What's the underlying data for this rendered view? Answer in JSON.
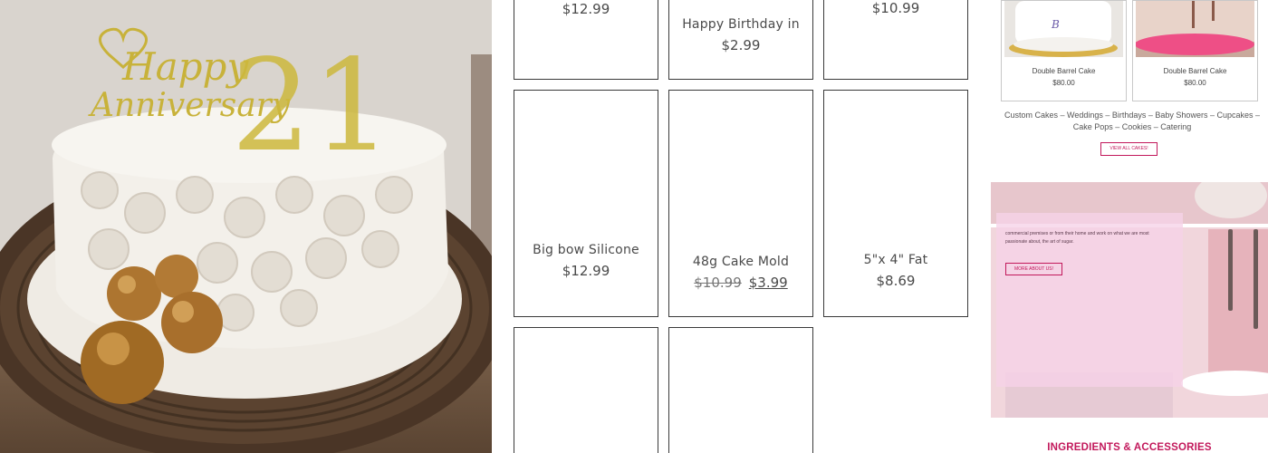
{
  "products": [
    {
      "id": "p1",
      "name": "",
      "price": "$12.99"
    },
    {
      "id": "p2",
      "name": "Happy Birthday in",
      "price": "$2.99"
    },
    {
      "id": "p3",
      "name": "",
      "price": "$10.99"
    },
    {
      "id": "p4",
      "name": "Big bow Silicone",
      "price": "$12.99"
    },
    {
      "id": "p5",
      "name": "48g Cake Mold",
      "old_price": "$10.99",
      "price": "$3.99"
    },
    {
      "id": "p6",
      "name": "5\"x 4\" Fat",
      "price": "$8.69"
    }
  ],
  "sidebar": {
    "featured": [
      {
        "name": "Double Barrel Cake",
        "price": "$80.00"
      },
      {
        "name": "Double Barrel Cake",
        "price": "$80.00"
      }
    ],
    "categories_text": "Custom Cakes – Weddings – Birthdays – Baby Showers – Cupcakes – Cake Pops – Cookies – Catering",
    "view_all_label": "VIEW ALL CAKES!",
    "about_text": "commercial premises or from their home and work on what we are most passionate about, the art of sugar.",
    "more_about_label": "MORE ABOUT US!",
    "ingredients_heading": "INGREDIENTS & ACCESSORIES"
  },
  "photo": {
    "topper_text_1": "Happy",
    "topper_text_2": "Anniversary",
    "topper_number": "21"
  },
  "colors": {
    "accent": "#c2185b",
    "card_border": "#3a3a3a",
    "gold": "#c8b23a"
  }
}
